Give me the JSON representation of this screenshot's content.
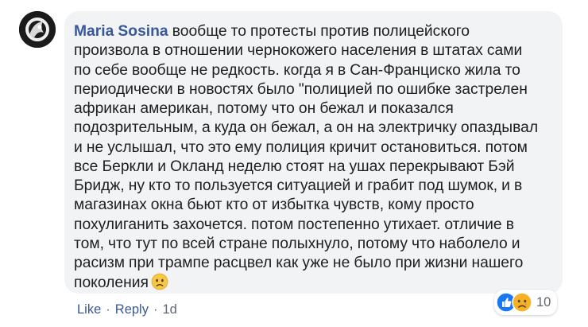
{
  "comment": {
    "author": "Maria Sosina",
    "lines": [
      " вообще то протесты против полицейского",
      "произвола в отношении чернокожего населения в штатах сами",
      "по себе вообще не редкость. когда я в Сан-Франциско жила то",
      "периодически в новостях было \"полицией по ошибке застрелен",
      "африкан американ, потому что он бежал и показался",
      "подозрительным, а куда он бежал, а он на электричку опаздывал",
      "и не услышал, что это ему полиция кричит остановиться. потом",
      "все Беркли и Окланд неделю стоят на ушах перекрывают Бэй",
      "Бридж, ну кто то пользуется ситуацией и грабит под шумок, и в",
      "магазинах окна бьют кто от избытка чувств, кому просто",
      "похулиганить захочется. потом постепенно утихает. отличие в",
      "том, что тут по всей стране полыхнуло, потому что наболело и",
      "расизм при трампе расцвел как уже не было при жизни нашего",
      "поколения"
    ],
    "end_emoji": "sad-face"
  },
  "actions": {
    "like_label": "Like",
    "separator": "·",
    "reply_label": "Reply",
    "time_label": "1d"
  },
  "reactions": {
    "types": [
      "like",
      "sad"
    ],
    "count": "10"
  },
  "colors": {
    "author_blue": "#385898",
    "bubble_bg": "#f2f3f5",
    "meta_gray": "#606770",
    "like_blue": "#1877f2",
    "sad_yellow": "#f7b125"
  }
}
